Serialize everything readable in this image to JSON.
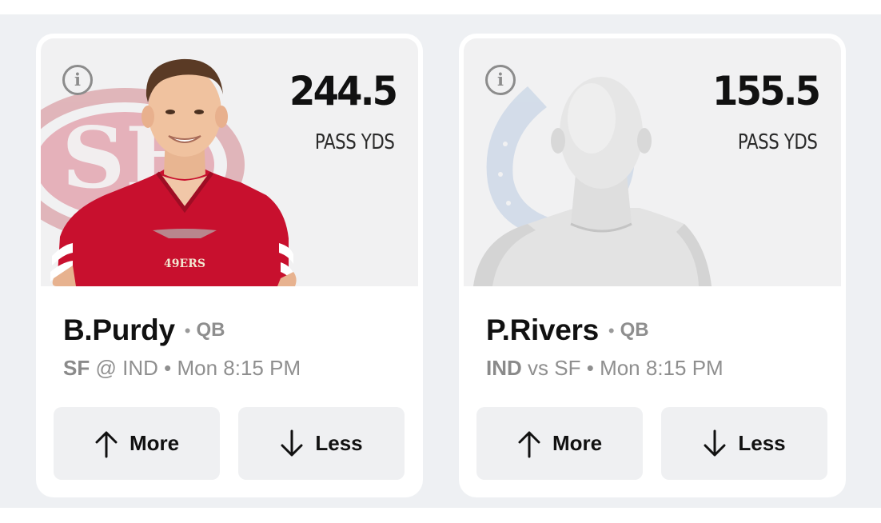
{
  "cards": [
    {
      "player": "B.Purdy",
      "position": "QB",
      "team": "SF",
      "separator": "@",
      "opponent": "IND",
      "game_time": "Mon 8:15 PM",
      "line": "244.5",
      "stat": "PASS YDS",
      "team_logo_text": "SF",
      "jersey_text": "49ERS",
      "more_label": "More",
      "less_label": "Less"
    },
    {
      "player": "P.Rivers",
      "position": "QB",
      "team": "IND",
      "separator": "vs",
      "opponent": "SF",
      "game_time": "Mon 8:15 PM",
      "line": "155.5",
      "stat": "PASS YDS",
      "more_label": "More",
      "less_label": "Less"
    }
  ],
  "icons": {
    "info": "info-icon",
    "more": "arrow-up-icon",
    "less": "arrow-down-icon"
  },
  "colors": {
    "background": "#eef0f3",
    "card": "#ffffff",
    "button": "#eff0f2",
    "niners_red": "#c8102e",
    "colts_blue": "#b9c9de"
  }
}
